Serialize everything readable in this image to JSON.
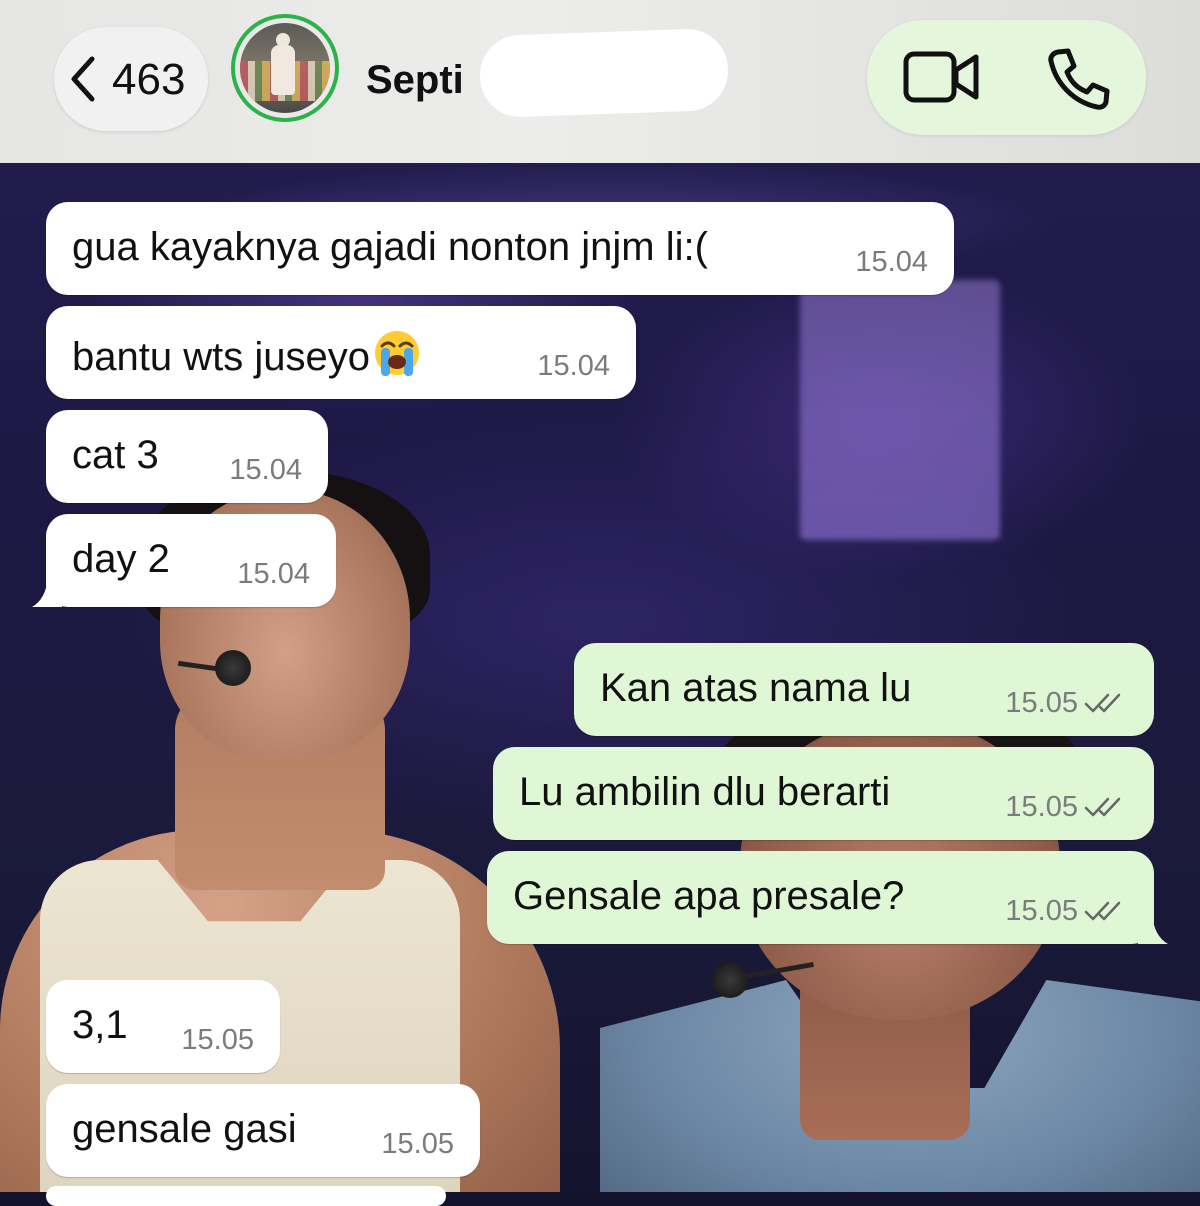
{
  "header": {
    "back_count": "463",
    "contact_name": "Septi",
    "icons": {
      "back": "chevron-left-icon",
      "video": "video-call-icon",
      "phone": "phone-icon"
    },
    "colors": {
      "status_ring": "#2bb34a",
      "call_pill": "#e4f6dc"
    }
  },
  "messages": [
    {
      "dir": "in",
      "text": "gua kayaknya gajadi nonton jnjm li:(",
      "time": "15.04"
    },
    {
      "dir": "in",
      "text": "bantu wts juseyo",
      "emoji": "loudly-crying-face-emoji",
      "time": "15.04"
    },
    {
      "dir": "in",
      "text": "cat 3",
      "time": "15.04"
    },
    {
      "dir": "in",
      "text": "day 2",
      "time": "15.04"
    },
    {
      "dir": "out",
      "text": "Kan atas nama lu",
      "time": "15.05",
      "status": "read"
    },
    {
      "dir": "out",
      "text": "Lu ambilin dlu berarti",
      "time": "15.05",
      "status": "read"
    },
    {
      "dir": "out",
      "text": "Gensale apa presale?",
      "time": "15.05",
      "status": "read"
    },
    {
      "dir": "in",
      "text": "3,1",
      "time": "15.05"
    },
    {
      "dir": "in",
      "text": "gensale gasi",
      "time": "15.05"
    }
  ],
  "colors": {
    "incoming_bubble": "#ffffff",
    "outgoing_bubble": "#dff7d4",
    "timestamp": "#7b7b7b"
  }
}
